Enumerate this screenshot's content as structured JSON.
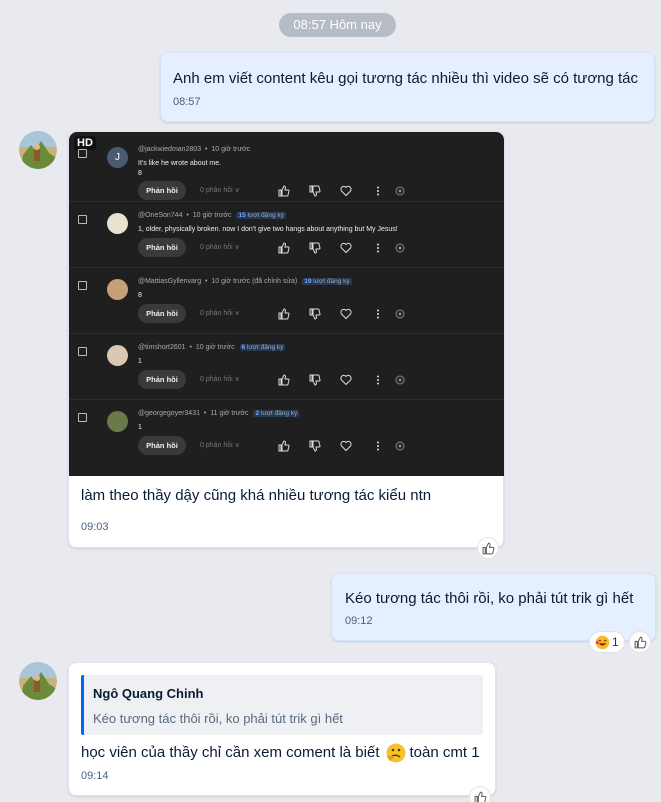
{
  "date_pill": "08:57 Hôm nay",
  "messages": [
    {
      "text": "Anh em viết content kêu gọi tương tác nhiều thì video sẽ có tương tác",
      "time": "08:57"
    },
    {
      "text": "làm theo thầy dậy cũng khá nhiều tương tác kiểu ntn",
      "time": "09:03"
    },
    {
      "text": "Kéo tương tác thôi rồi, ko phải  tút trik gì hết",
      "time": "09:12",
      "reaction_count": "1"
    },
    {
      "quote_author": "Ngô Quang Chinh",
      "quote_text": "Kéo tương tác thôi rồi, ko phải tút trik gì hết",
      "text": "học viên của thầy chỉ cần xem coment là biết",
      "text_after": "toàn cmt 1",
      "time": "09:14"
    }
  ],
  "yt": {
    "hd": "HD",
    "reply_label": "Phản hồi",
    "replies_label": "0 phản hồi",
    "comments": [
      {
        "author": "@jackwiedman2803",
        "time": "10 giờ trước",
        "sub": "",
        "sub_text": "",
        "lines": [
          "It's like he wrote about me.",
          "8"
        ],
        "avatar_letter": "J"
      },
      {
        "author": "@OneSon744",
        "time": "10 giờ trước",
        "sub": "15",
        "sub_text": "lượt đăng ký",
        "lines": [
          "1, older, physically broken. now I don't give two hangs about anything but My Jesus!"
        ],
        "avatar_letter": ""
      },
      {
        "author": "@MattiasGyllenvarg",
        "time": "10 giờ trước (đã chỉnh sửa)",
        "sub": "19",
        "sub_text": "lượt đăng ký",
        "lines": [
          "8"
        ],
        "avatar_letter": ""
      },
      {
        "author": "@timshort2601",
        "time": "10 giờ trước",
        "sub": "6",
        "sub_text": "lượt đăng ký",
        "lines": [
          "1"
        ],
        "avatar_letter": ""
      },
      {
        "author": "@georgegoyer3431",
        "time": "11 giờ trước",
        "sub": "2",
        "sub_text": "lượt đăng ký",
        "lines": [
          "1"
        ],
        "avatar_letter": ""
      }
    ]
  },
  "colors": {
    "background": "#e8eaef",
    "outgoing": "#e5efff",
    "incoming": "#ffffff",
    "quote_bar": "#0068ff"
  }
}
